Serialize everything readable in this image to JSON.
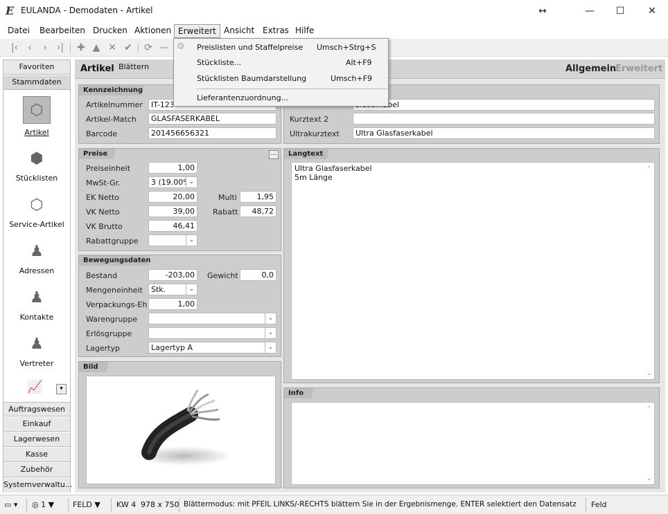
{
  "window": {
    "title": "EULANDA - Demodaten - Artikel",
    "app_icon": "E",
    "controls": {
      "restore": "↔",
      "minimize": "—",
      "maximize": "☐",
      "close": "✕"
    }
  },
  "menubar": [
    "Datei",
    "Bearbeiten",
    "Drucken",
    "Aktionen",
    "Erweitert",
    "Ansicht",
    "Extras",
    "Hilfe"
  ],
  "toolbar": {
    "icons": [
      "first-icon",
      "prev-icon",
      "next-icon",
      "last-icon",
      "add-icon",
      "up-icon",
      "delete-icon",
      "check-icon",
      "refresh-icon",
      "minus-icon"
    ],
    "glyphs": [
      "|‹",
      "‹",
      "›",
      "›|",
      "✚",
      "▲",
      "✕",
      "✔",
      "⟳",
      "—"
    ]
  },
  "dropdown_menu": {
    "items": [
      {
        "label": "Preislisten und Staffelpreise",
        "shortcut": "Umsch+Strg+S"
      },
      {
        "label": "Stückliste...",
        "shortcut": "Alt+F9"
      },
      {
        "label": "Stücklisten Baumdarstellung",
        "shortcut": "Umsch+F9"
      },
      {
        "label": "Lieferantenzuordnung...",
        "shortcut": ""
      }
    ]
  },
  "leftnav": {
    "tabs_top": [
      "Favoriten",
      "Stammdaten"
    ],
    "items": [
      {
        "label": "Artikel",
        "icon": "cube-icon"
      },
      {
        "label": "Stücklisten",
        "icon": "cubes-icon"
      },
      {
        "label": "Service-Artikel",
        "icon": "cube-service-icon"
      },
      {
        "label": "Adressen",
        "icon": "person-icon"
      },
      {
        "label": "Kontakte",
        "icon": "person-icon"
      },
      {
        "label": "Vertreter",
        "icon": "person-icon"
      }
    ],
    "chart_icon_glyph": "📈",
    "dropdown_glyph": "▾",
    "tabs_bottom": [
      "Auftragswesen",
      "Einkauf",
      "Lagerwesen",
      "Kasse",
      "Zubehör",
      "Systemverwaltu..."
    ]
  },
  "header": {
    "title": "Artikel",
    "mode": "Blättern",
    "tab_active": "Allgemein",
    "tab_inactive": "Erweitert"
  },
  "kennzeichnung": {
    "title": "Kennzeichnung",
    "artikelnummer_label": "Artikelnummer",
    "artikelnummer": "IT-123-",
    "artikelmatch_label": "Artikel-Match",
    "artikelmatch": "GLASFASERKABEL",
    "barcode_label": "Barcode",
    "barcode": "201456656321",
    "kurztext1": "sfaserkabel",
    "kurztext2_label": "Kurztext 2",
    "kurztext2": "",
    "ultrakurztext_label": "Ultrakurztext",
    "ultrakurztext": "Ultra Glasfaserkabel"
  },
  "preise": {
    "title": "Preise",
    "more_button": "...",
    "preiseinheit_label": "Preiseinheit",
    "preiseinheit": "1,00",
    "mwst_label": "MwSt-Gr.",
    "mwst": "3 (19.00%)",
    "ek_label": "EK Netto",
    "ek": "20,00",
    "multi_label": "Multi",
    "multi": "1,95",
    "vk_label": "VK Netto",
    "vk": "39,00",
    "rabatt_label": "Rabatt",
    "rabatt": "48,72",
    "vkbrutto_label": "VK Brutto",
    "vkbrutto": "46,41",
    "rabattgruppe_label": "Rabattgruppe",
    "rabattgruppe": ""
  },
  "bewegung": {
    "title": "Bewegungsdaten",
    "bestand_label": "Bestand",
    "bestand": "-203,00",
    "gewicht_label": "Gewicht",
    "gewicht": "0,0",
    "mengeneinheit_label": "Mengeneinheit",
    "mengeneinheit": "Stk.",
    "verpackung_label": "Verpackungs-Eh",
    "verpackung": "1,00",
    "warengruppe_label": "Warengruppe",
    "warengruppe": "",
    "erloesgruppe_label": "Erlösgruppe",
    "erloesgruppe": "",
    "lagertyp_label": "Lagertyp",
    "lagertyp": "Lagertyp A"
  },
  "bild": {
    "title": "Bild"
  },
  "langtext": {
    "title": "Langtext",
    "line1": "Ultra Glasfaserkabel",
    "line2": "5m Länge"
  },
  "info": {
    "title": "Info",
    "text": ""
  },
  "scroll_glyphs": {
    "up": "⌃",
    "down": "⌄"
  },
  "dd_glyph": "⌄",
  "statusbar": {
    "window_glyph": "▭ ▾",
    "zoom": "◎ 1 ▼",
    "field_mode": "FELD ▼",
    "week": "KW 4",
    "resolution": "978 x 750",
    "message": "Blättermodus: mit PFEIL LINKS/-RECHTS blättern Sie in der Ergebnismenge. ENTER selektiert den Datensatz",
    "field": "Feld"
  }
}
